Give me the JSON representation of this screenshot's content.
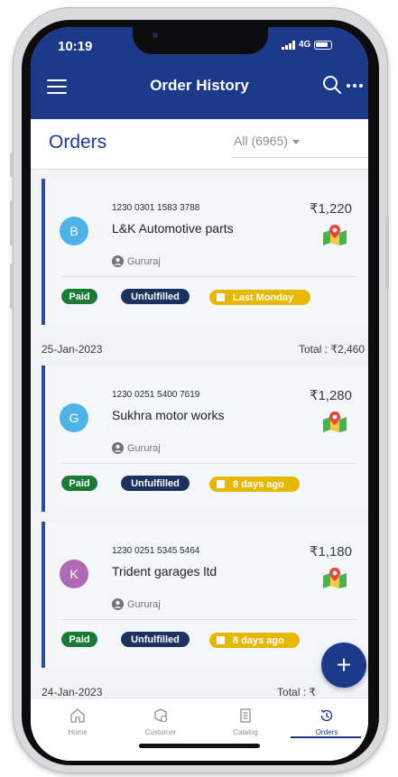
{
  "status_bar": {
    "time": "10:19",
    "network": "4G"
  },
  "app_bar": {
    "title": "Order History"
  },
  "orders_header": {
    "title": "Orders",
    "filter": "All (6965)"
  },
  "orders": [
    {
      "avatar": "B",
      "avatar_color": "#4fb3e8",
      "order_no": "1230 0301 1583 3788",
      "customer": "L&K Automotive parts",
      "amount": "₹1,220",
      "agent": "Gururaj",
      "payment": "Paid",
      "fulfillment": "Unfulfilled",
      "due": "Last Monday"
    },
    {
      "avatar": "G",
      "avatar_color": "#4fb3e8",
      "order_no": "1230 0251 5400 7619",
      "customer": "Sukhra motor works",
      "amount": "₹1,280",
      "agent": "Gururaj",
      "payment": "Paid",
      "fulfillment": "Unfulfilled",
      "due": "8 days ago"
    },
    {
      "avatar": "K",
      "avatar_color": "#b06ab3",
      "order_no": "1230 0251 5345 5464",
      "customer": "Trident garages ltd",
      "amount": "₹1,180",
      "agent": "Gururaj",
      "payment": "Paid",
      "fulfillment": "Unfulfilled",
      "due": "8 days ago"
    }
  ],
  "date_groups": [
    {
      "date": "25-Jan-2023",
      "total": "Total : ₹2,460"
    },
    {
      "date": "24-Jan-2023",
      "total": "Total : ₹"
    }
  ],
  "fab": {
    "label": "+"
  },
  "bottom_nav": [
    {
      "label": "Home"
    },
    {
      "label": "Customer"
    },
    {
      "label": "Catalog"
    },
    {
      "label": "Orders"
    }
  ],
  "colors": {
    "primary": "#1d3a8a",
    "paid": "#1b7a35",
    "unfulfilled": "#1d3161",
    "due": "#e6b800"
  }
}
